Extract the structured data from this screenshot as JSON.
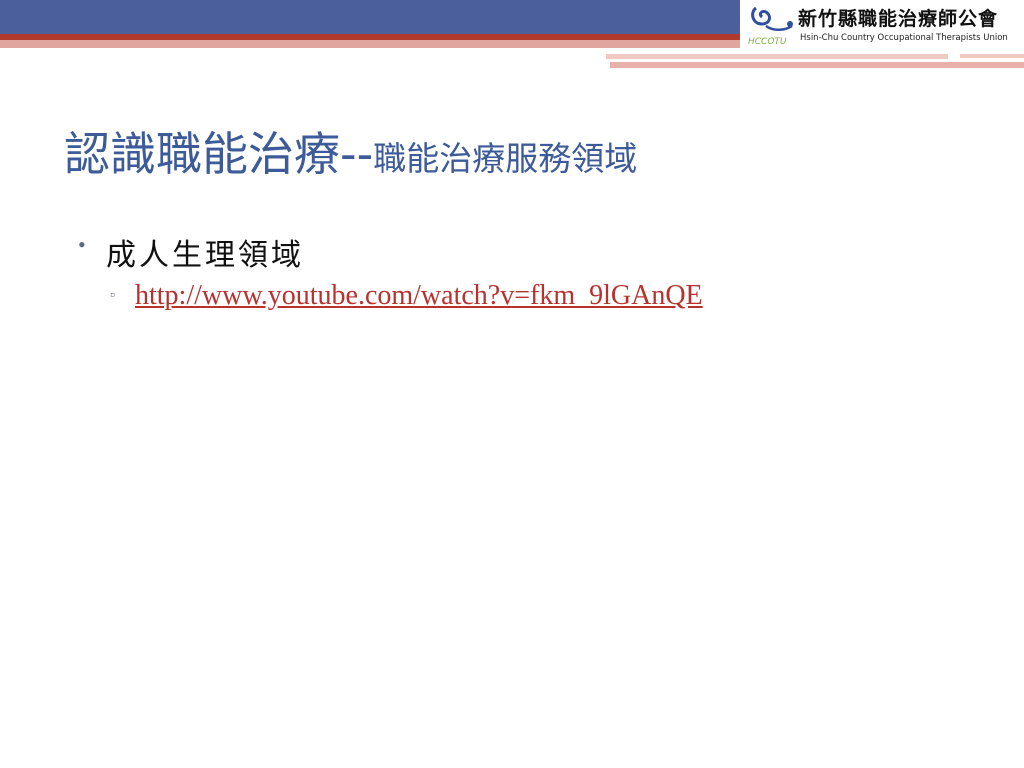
{
  "header": {
    "logo_zh": "新竹縣職能治療師公會",
    "logo_en": "Hsin-Chu Country Occupational Therapists Union",
    "logo_mark_text": "HCCOTU"
  },
  "slide": {
    "title_main": "認識職能治療--",
    "title_sub": "職能治療服務領域"
  },
  "content": {
    "bullet1_text": "成人生理領域",
    "link_text": "http://www.youtube.com/watch?v=fkm_9lGAnQE"
  },
  "colors": {
    "title": "#3d5a99",
    "link": "#b8312f",
    "band_blue": "#4a5f9b",
    "band_red": "#b23a2c"
  }
}
